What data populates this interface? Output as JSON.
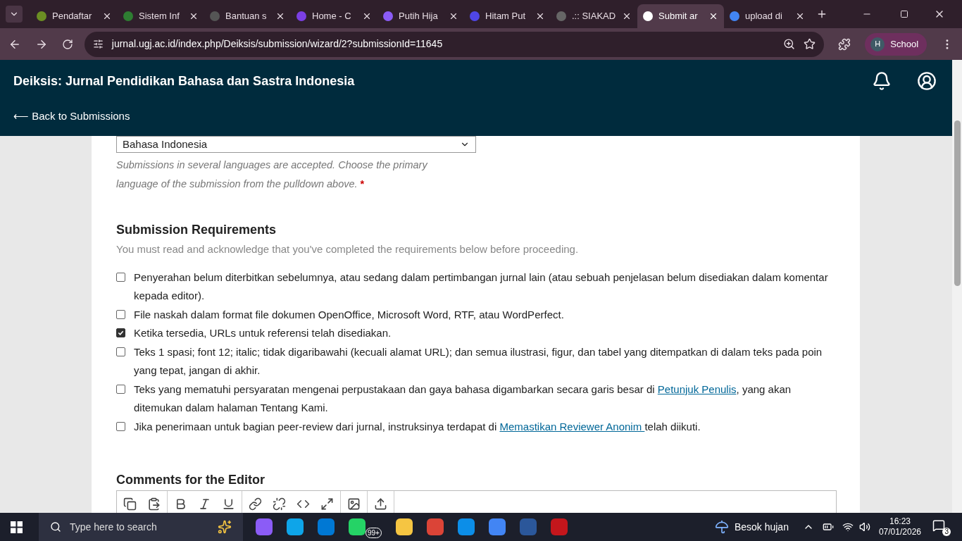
{
  "browser": {
    "tabs": [
      {
        "title": "Pendaftar",
        "selected": false
      },
      {
        "title": "Sistem Inf",
        "selected": false
      },
      {
        "title": "Bantuan s",
        "selected": false
      },
      {
        "title": "Home - C",
        "selected": false
      },
      {
        "title": "Putih Hija",
        "selected": false
      },
      {
        "title": "Hitam Put",
        "selected": false
      },
      {
        "title": ".:: SIAKAD",
        "selected": false
      },
      {
        "title": "Submit ar",
        "selected": true
      },
      {
        "title": "upload di",
        "selected": false
      }
    ],
    "url": "jurnal.ugj.ac.id/index.php/Deiksis/submission/wizard/2?submissionId=11645",
    "profile": {
      "initial": "H",
      "name": "School"
    }
  },
  "header": {
    "title": "Deiksis: Jurnal Pendidikan Bahasa dan Sastra Indonesia",
    "back_link": "⟵ Back to Submissions"
  },
  "language": {
    "value": "Bahasa Indonesia",
    "help": "Submissions in several languages are accepted. Choose the primary language of the submission from the pulldown above.",
    "required_mark": "*"
  },
  "requirements": {
    "title": "Submission Requirements",
    "description": "You must read and acknowledge that you've completed the requirements below before proceeding.",
    "items": [
      {
        "checked": false,
        "parts": [
          {
            "kind": "text",
            "text": "Penyerahan belum diterbitkan sebelumnya, atau sedang dalam pertimbangan jurnal lain (atau sebuah penjelasan belum disediakan dalam komentar kepada editor)."
          }
        ]
      },
      {
        "checked": false,
        "parts": [
          {
            "kind": "text",
            "text": "File naskah dalam format file dokumen OpenOffice, Microsoft Word, RTF, atau WordPerfect."
          }
        ]
      },
      {
        "checked": true,
        "parts": [
          {
            "kind": "text",
            "text": "Ketika tersedia, URLs untuk referensi telah disediakan."
          }
        ]
      },
      {
        "checked": false,
        "parts": [
          {
            "kind": "text",
            "text": "Teks 1 spasi; font 12; italic; tidak digaribawahi (kecuali alamat URL); dan semua ilustrasi, figur, dan tabel yang ditempatkan di dalam teks pada poin yang tepat, jangan di akhir."
          }
        ]
      },
      {
        "checked": false,
        "parts": [
          {
            "kind": "text",
            "text": "Teks yang mematuhi persyaratan mengenai perpustakaan dan gaya bahasa digambarkan secara garis besar di "
          },
          {
            "kind": "link",
            "text": "Petunjuk Penulis"
          },
          {
            "kind": "text",
            "text": ", yang akan ditemukan dalam halaman Tentang Kami."
          }
        ]
      },
      {
        "checked": false,
        "parts": [
          {
            "kind": "text",
            "text": "Jika penerimaan untuk bagian peer-review dari jurnal, instruksinya terdapat di "
          },
          {
            "kind": "link",
            "text": "Memastikan Reviewer Anonim "
          },
          {
            "kind": "text",
            "text": "telah diikuti."
          }
        ]
      }
    ]
  },
  "comments": {
    "title": "Comments for the Editor"
  },
  "taskbar": {
    "search_placeholder": "Type here to search",
    "badge": "99+",
    "weather": "Besok hujan",
    "time": "16:23",
    "date": "07/01/2026",
    "notifications": "3"
  }
}
